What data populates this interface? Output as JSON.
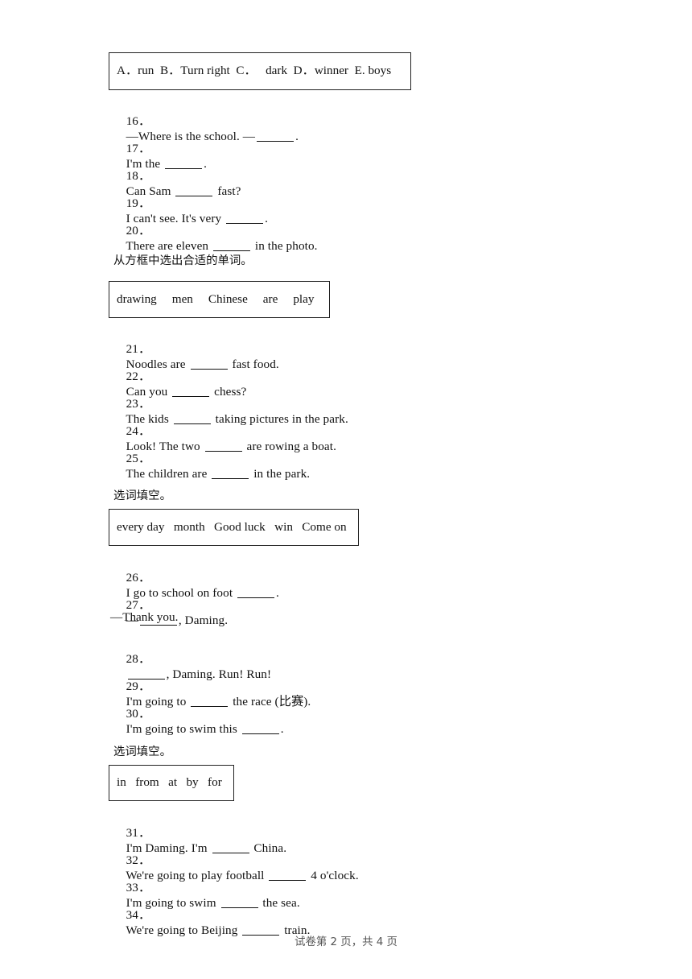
{
  "document": {
    "footer": "试卷第 2 页，共 4 页",
    "page_number": "2",
    "total_pages": "4"
  },
  "sections": [
    {
      "id": "section-matching-16-20",
      "instruction": "",
      "word_bank": "A．run  B．Turn right  C．   dark  D．winner  E. boys",
      "word_bank_items": [
        "A．run",
        "B．Turn right",
        "C．dark",
        "D．winner",
        "E. boys"
      ],
      "questions": [
        {
          "number": "16．",
          "before": "—Where is the school. —",
          "after": "."
        },
        {
          "number": "17．",
          "before": "I'm the ",
          "after": "."
        },
        {
          "number": "18．",
          "before": "Can Sam ",
          "after": " fast?"
        },
        {
          "number": "19．",
          "before": "I can't see. It's very ",
          "after": "."
        },
        {
          "number": "20．",
          "before": "There are eleven ",
          "after": " in the photo."
        }
      ]
    },
    {
      "id": "section-wordbank-21-25",
      "instruction": "从方框中选出合适的单词。",
      "word_bank": "drawing     men     Chinese     are     play",
      "word_bank_items": [
        "drawing",
        "men",
        "Chinese",
        "are",
        "play"
      ],
      "questions": [
        {
          "number": "21．",
          "before": "Noodles are ",
          "after": " fast food."
        },
        {
          "number": "22．",
          "before": "Can you ",
          "after": " chess?"
        },
        {
          "number": "23．",
          "before": "The kids ",
          "after": " taking pictures in the park."
        },
        {
          "number": "24．",
          "before": "Look! The two ",
          "after": " are rowing a boat."
        },
        {
          "number": "25．",
          "before": "The children are ",
          "after": " in the park."
        }
      ]
    },
    {
      "id": "section-wordbank-26-30",
      "instruction": "选词填空。",
      "word_bank": "every day   month   Good luck   win   Come on",
      "word_bank_items": [
        "every day",
        "month",
        "Good luck",
        "win",
        "Come on"
      ],
      "questions": [
        {
          "number": "26．",
          "before": "I go to school on foot ",
          "after": "."
        },
        {
          "number": "27．",
          "before": "—",
          "after": ", Daming.",
          "continuation": "—Thank you."
        },
        {
          "number": "28．",
          "before": "",
          "after": ", Daming. Run! Run!"
        },
        {
          "number": "29．",
          "before": "I'm going to ",
          "after": " the race (比赛)."
        },
        {
          "number": "30．",
          "before": "I'm going to swim this ",
          "after": "."
        }
      ]
    },
    {
      "id": "section-wordbank-31-34",
      "instruction": "选词填空。",
      "word_bank": "in   from   at   by   for",
      "word_bank_items": [
        "in",
        "from",
        "at",
        "by",
        "for"
      ],
      "questions": [
        {
          "number": "31．",
          "before": "I'm Daming. I'm ",
          "after": " China."
        },
        {
          "number": "32．",
          "before": "We're going to play football ",
          "after": " 4 o'clock."
        },
        {
          "number": "33．",
          "before": "I'm going to swim ",
          "after": " the sea."
        },
        {
          "number": "34．",
          "before": "We're going to Beijing ",
          "after": " train."
        }
      ]
    }
  ]
}
